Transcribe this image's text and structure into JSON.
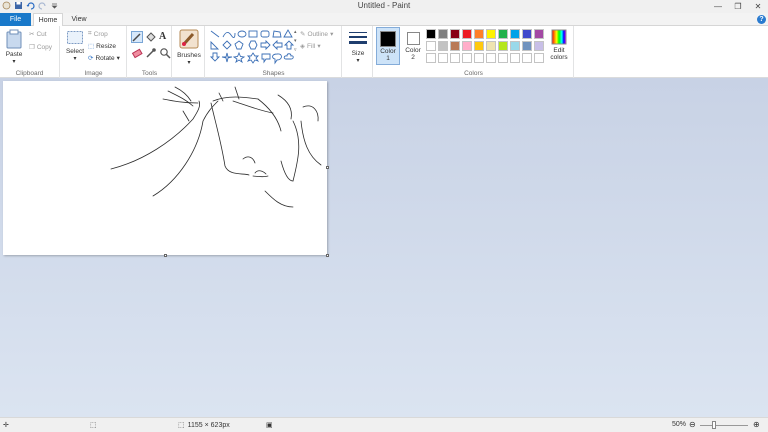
{
  "window": {
    "title": "Untitled - Paint"
  },
  "tabs": {
    "file": "File",
    "home": "Home",
    "view": "View"
  },
  "clipboard": {
    "paste": "Paste",
    "cut": "Cut",
    "copy": "Copy",
    "label": "Clipboard"
  },
  "image": {
    "select": "Select",
    "crop": "Crop",
    "resize": "Resize",
    "rotate": "Rotate",
    "label": "Image"
  },
  "tools": {
    "label": "Tools"
  },
  "brushes": {
    "label": "Brushes"
  },
  "shapes": {
    "outline": "Outline",
    "fill": "Fill",
    "label": "Shapes"
  },
  "size": {
    "label": "Size"
  },
  "colors": {
    "color1": "Color\n1",
    "color2": "Color\n2",
    "edit": "Edit colors",
    "label": "Colors",
    "color1_value": "#000000",
    "color2_value": "#ffffff",
    "palette_row1": [
      "#000000",
      "#7f7f7f",
      "#880015",
      "#ed1c24",
      "#ff7f27",
      "#fff200",
      "#22b14c",
      "#00a2e8",
      "#3f48cc",
      "#a349a4"
    ],
    "palette_row2": [
      "#ffffff",
      "#c3c3c3",
      "#b97a57",
      "#ffaec9",
      "#ffc90e",
      "#efe4b0",
      "#b5e61d",
      "#99d9ea",
      "#7092be",
      "#c8bfe7"
    ]
  },
  "status": {
    "dimensions": "1155 × 623px",
    "zoom": "50%"
  }
}
